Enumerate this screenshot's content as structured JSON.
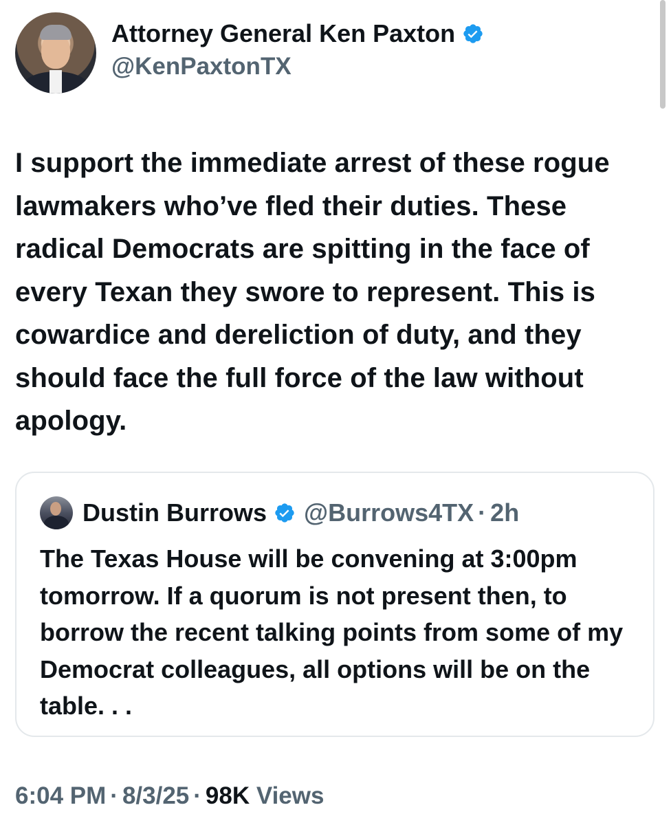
{
  "author": {
    "display_name": "Attorney General Ken Paxton",
    "handle": "@KenPaxtonTX",
    "verified_icon": "verified-badge-icon",
    "avatar_icon": "profile-photo"
  },
  "tweet": {
    "text": "I support the immediate arrest of these rogue lawmakers who’ve fled their duties. These radical Democrats are spitting in the face of every Texan they swore to represent. This is cowardice and dereliction of duty, and they should face the full force of the law without apology."
  },
  "quoted_tweet": {
    "display_name": "Dustin Burrows",
    "handle": "@Burrows4TX",
    "separator": "·",
    "time_ago": "2h",
    "text": "The Texas House will be convening at 3:00pm tomorrow. If a quorum is not present then, to borrow the recent talking points from some of my Democrat colleagues, all options will be on the table. . ."
  },
  "meta": {
    "time": "6:04 PM",
    "separator": "·",
    "date": "8/3/25",
    "views_count": "98K",
    "views_label": "Views"
  },
  "colors": {
    "text_primary": "#0f1419",
    "text_secondary": "#536471",
    "verified_blue": "#1d9bf0",
    "border": "#e4e8eb"
  }
}
